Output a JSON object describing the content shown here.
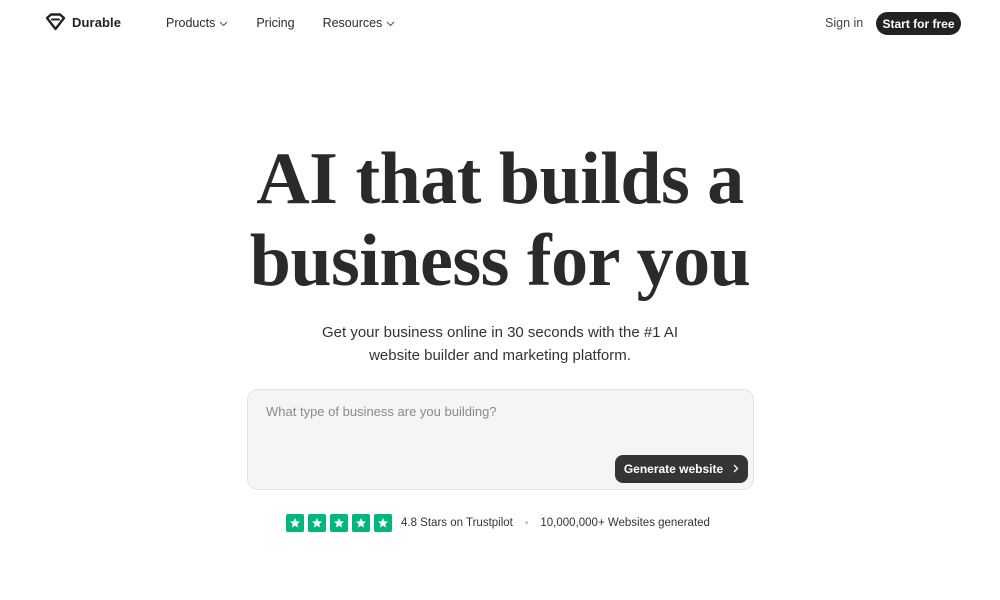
{
  "nav": {
    "brand": "Durable",
    "links": [
      {
        "label": "Products"
      },
      {
        "label": "Pricing"
      },
      {
        "label": "Resources"
      }
    ],
    "sign_in": "Sign in",
    "cta": "Start for free"
  },
  "hero": {
    "title_line1": "AI that builds a",
    "title_line2": "business for you",
    "subtitle_line1": "Get your business online in 30 seconds with the #1 AI",
    "subtitle_line2": "website builder and marketing platform."
  },
  "prompt": {
    "placeholder": "What type of business are you building?",
    "value": "",
    "button_label": "Generate website"
  },
  "trust": {
    "stars": 5,
    "rating_text": "4.8 Stars on Trustpilot",
    "separator": "•",
    "count_text": "10,000,000+ Websites generated"
  },
  "colors": {
    "primary_dark": "#222222",
    "button_dark": "#353535",
    "trustpilot_green": "#00b67a",
    "prompt_bg": "#f5f5f5"
  },
  "icons": {
    "logo": "diamond-logo-icon",
    "dropdown": "chevron-down-icon",
    "button_arrow": "chevron-right-icon",
    "rating": "star-icon"
  }
}
